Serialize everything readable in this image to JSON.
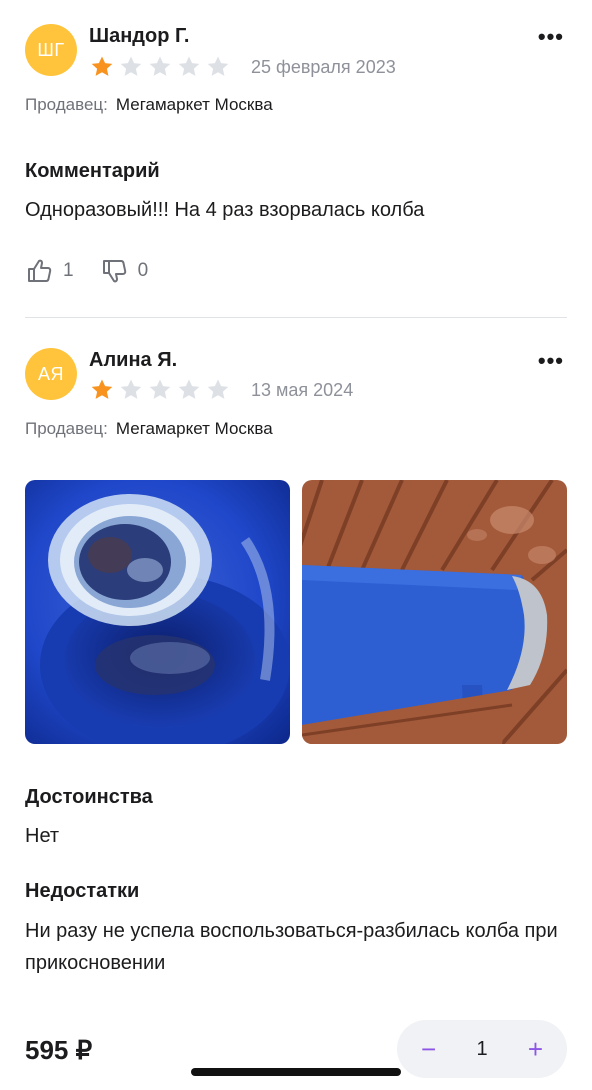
{
  "reviews": [
    {
      "avatar_initials": "ШГ",
      "author": "Шандор Г.",
      "rating": 1,
      "max_rating": 5,
      "date": "25 февраля 2023",
      "seller_label": "Продавец:",
      "seller_name": "Мегамаркет Москва",
      "comment_title": "Комментарий",
      "comment_text": "Одноразовый!!! На 4 раз взорвалась колба",
      "likes": "1",
      "dislikes": "0"
    },
    {
      "avatar_initials": "АЯ",
      "author": "Алина Я.",
      "rating": 1,
      "max_rating": 5,
      "date": "13 мая 2024",
      "seller_label": "Продавец:",
      "seller_name": "Мегамаркет Москва",
      "pros_title": "Достоинства",
      "pros_text": "Нет",
      "cons_title": "Недостатки",
      "cons_text": "Ни разу не успела воспользоваться-разбилась колба при прикосновении"
    }
  ],
  "more_icon": "more-dots-icon",
  "bottom_bar": {
    "price": "595 ₽",
    "quantity": "1",
    "minus": "−",
    "plus": "+"
  },
  "colors": {
    "avatar": "#ffc43b",
    "star_filled": "#f7931e",
    "star_empty": "#dde1e6",
    "accent": "#8c55e6"
  }
}
